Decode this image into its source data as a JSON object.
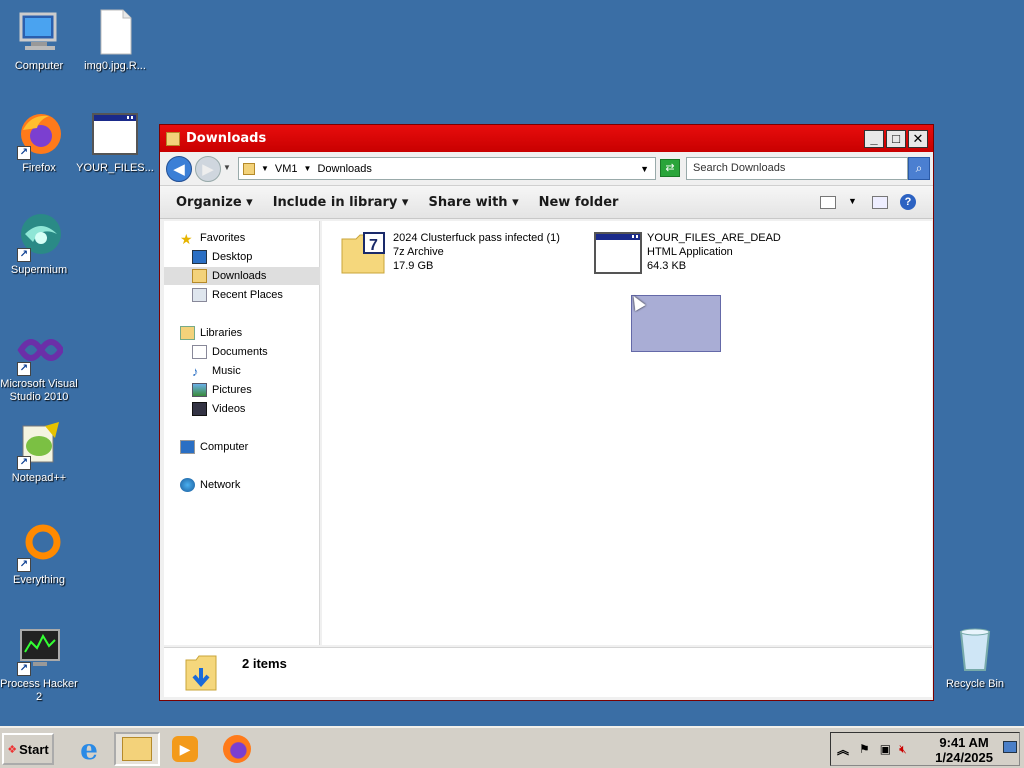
{
  "desktop": {
    "icons": [
      {
        "label": "Computer"
      },
      {
        "label": "img0.jpg.R..."
      },
      {
        "label": "Firefox"
      },
      {
        "label": "YOUR_FILES..."
      },
      {
        "label": "Supermium"
      },
      {
        "label": "Microsoft Visual Studio 2010"
      },
      {
        "label": "Notepad++"
      },
      {
        "label": "Everything"
      },
      {
        "label": "Process Hacker 2"
      },
      {
        "label": "Recycle Bin"
      }
    ]
  },
  "window": {
    "title": "Downloads",
    "breadcrumb": [
      "VM1",
      "Downloads"
    ],
    "search_placeholder": "Search Downloads",
    "toolbar": {
      "organize": "Organize",
      "include_in_library": "Include in library",
      "share_with": "Share with",
      "new_folder": "New folder"
    },
    "nav": {
      "favorites": "Favorites",
      "desktop": "Desktop",
      "downloads": "Downloads",
      "recent_places": "Recent Places",
      "libraries": "Libraries",
      "documents": "Documents",
      "music": "Music",
      "pictures": "Pictures",
      "videos": "Videos",
      "computer": "Computer",
      "network": "Network"
    },
    "files": [
      {
        "name": "2024 Clusterfuck pass infected (1)",
        "type": "7z Archive",
        "size": "17.9 GB",
        "icon": "7z-archive-icon"
      },
      {
        "name": "YOUR_FILES_ARE_DEAD",
        "type": "HTML Application",
        "size": "64.3 KB",
        "icon": "hta-window-icon"
      }
    ],
    "status": "2 items"
  },
  "taskbar": {
    "start_label": "Start",
    "time": "9:41 AM",
    "date": "1/24/2025"
  },
  "colors": {
    "desktop": "#3a6ea5",
    "titlebar": "#d40000",
    "selection": "#9b9fce"
  }
}
